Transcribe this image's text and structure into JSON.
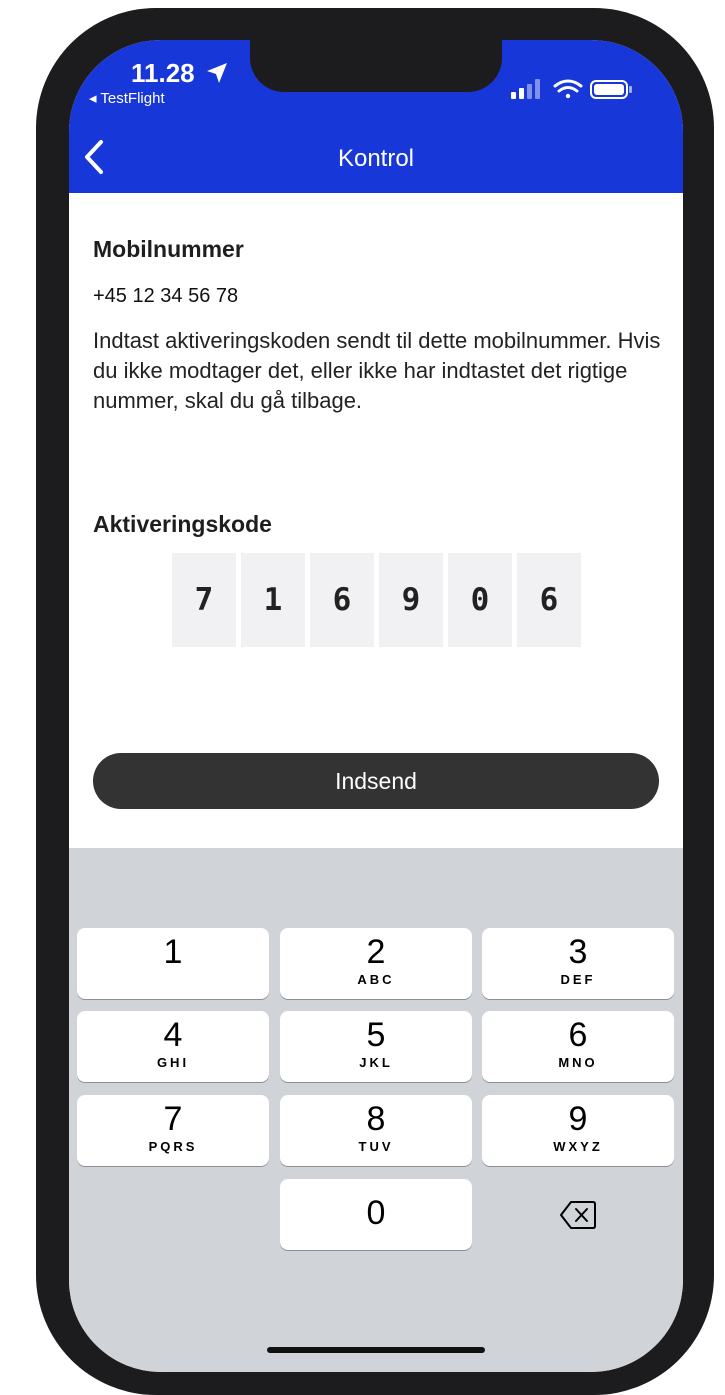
{
  "status_bar": {
    "time": "11.28",
    "back_app": "◂ TestFlight"
  },
  "nav": {
    "title": "Kontrol"
  },
  "mobile": {
    "label": "Mobilnummer",
    "number": "+45 12 34 56 78",
    "description": "Indtast aktiveringskoden sendt til dette mobilnummer. Hvis du ikke modtager det, eller ikke har indtastet det rigtige nummer, skal du gå tilbage."
  },
  "activation": {
    "label": "Aktiveringskode",
    "digits": [
      "7",
      "1",
      "6",
      "9",
      "0",
      "6"
    ]
  },
  "submit": {
    "label": "Indsend"
  },
  "keypad": {
    "keys": [
      {
        "num": "1",
        "letters": ""
      },
      {
        "num": "2",
        "letters": "ABC"
      },
      {
        "num": "3",
        "letters": "DEF"
      },
      {
        "num": "4",
        "letters": "GHI"
      },
      {
        "num": "5",
        "letters": "JKL"
      },
      {
        "num": "6",
        "letters": "MNO"
      },
      {
        "num": "7",
        "letters": "PQRS"
      },
      {
        "num": "8",
        "letters": "TUV"
      },
      {
        "num": "9",
        "letters": "WXYZ"
      },
      {
        "num": "0",
        "letters": ""
      }
    ]
  },
  "colors": {
    "header": "#1837d9",
    "button": "#333333",
    "keyboard": "#d0d3d8"
  }
}
